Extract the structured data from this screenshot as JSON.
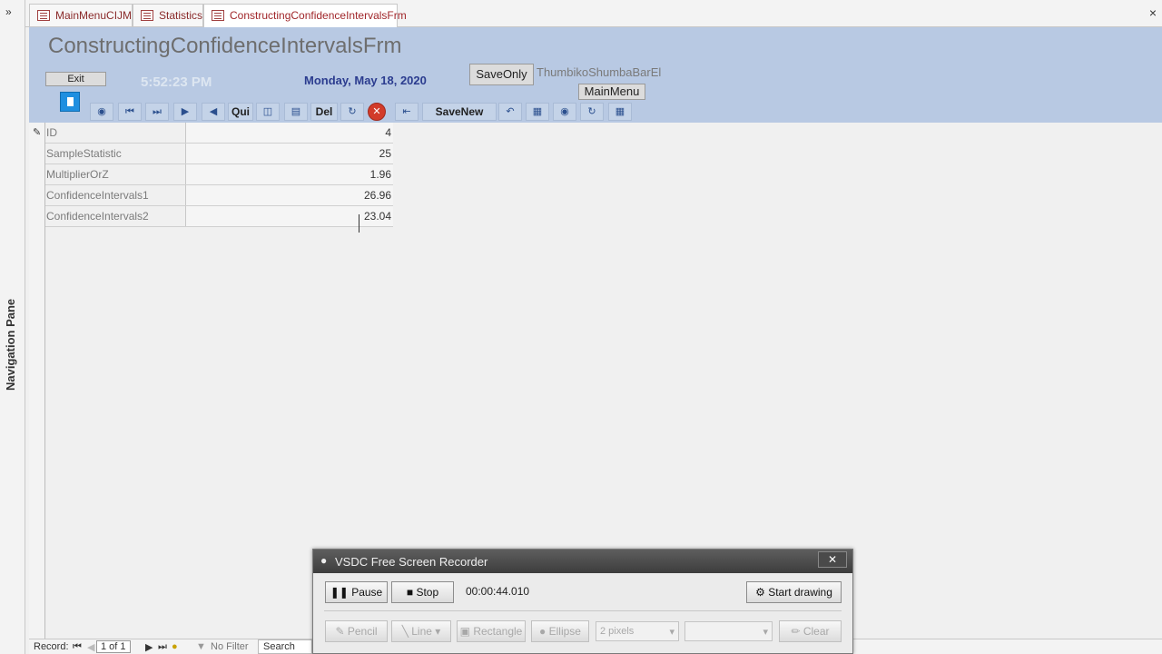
{
  "nav": {
    "toggle": "»",
    "label": "Navigation Pane"
  },
  "tabs": [
    {
      "label": "MainMenuCIJM"
    },
    {
      "label": "Statistics"
    },
    {
      "label": "ConstructingConfidenceIntervalsFrm"
    }
  ],
  "window_close": "×",
  "header": {
    "title": "ConstructingConfidenceIntervalsFrm",
    "exit_label": "Exit",
    "clock": "5:52:23 PM",
    "date": "Monday, May 18, 2020",
    "save_only_label": "SaveOnly",
    "username": "ThumbikoShumbaBarEl",
    "main_menu_label": "MainMenu",
    "toolbar": {
      "find_icon": "binoculars-icon",
      "qui_label": "Qui",
      "del_label": "Del",
      "savenew_label": "SaveNew"
    }
  },
  "record": {
    "fields": [
      {
        "label": "ID",
        "value": "4"
      },
      {
        "label": "SampleStatistic",
        "value": "25"
      },
      {
        "label": "MultiplierOrZ",
        "value": "1.96"
      },
      {
        "label": "ConfidenceIntervals1",
        "value": "26.96"
      },
      {
        "label": "ConfidenceIntervals2",
        "value": "23.04"
      }
    ]
  },
  "statusbar": {
    "record_label": "Record:",
    "position": "1 of 1",
    "filter": "No Filter",
    "search": "Search"
  },
  "recorder": {
    "title": "VSDC Free Screen Recorder",
    "close": "✕",
    "pause_label": "Pause",
    "stop_label": "Stop",
    "elapsed": "00:00:44.010",
    "start_drawing_label": "Start drawing",
    "pencil_label": "Pencil",
    "line_label": "Line",
    "rectangle_label": "Rectangle",
    "ellipse_label": "Ellipse",
    "pixels_label": "2 pixels",
    "clear_label": "Clear"
  }
}
